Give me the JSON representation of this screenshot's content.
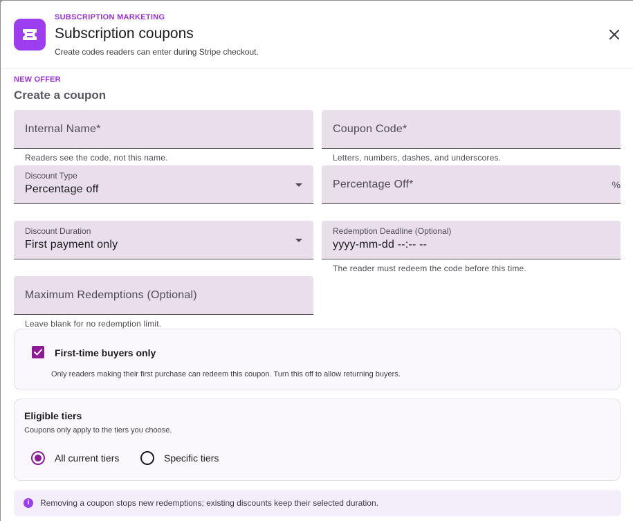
{
  "header": {
    "eyebrow": "SUBSCRIPTION MARKETING",
    "title": "Subscription coupons",
    "subtitle": "Create codes readers can enter during Stripe checkout.",
    "icon": "ticket-icon",
    "close_icon": "close-icon"
  },
  "section": {
    "eyebrow": "NEW OFFER",
    "title": "Create a coupon"
  },
  "fields": {
    "internal_name": {
      "placeholder": "Internal Name*",
      "help": "Readers see the code, not this name."
    },
    "coupon_code": {
      "placeholder": "Coupon Code*",
      "help": "Letters, numbers, dashes, and underscores."
    },
    "discount_type": {
      "label": "Discount Type",
      "value": "Percentage off"
    },
    "percentage_off": {
      "placeholder": "Percentage Off*",
      "suffix": "%"
    },
    "discount_duration": {
      "label": "Discount Duration",
      "value": "First payment only"
    },
    "redemption_deadline": {
      "label": "Redemption Deadline (Optional)",
      "value": "yyyy-mm-dd --:-- --",
      "help": "The reader must redeem the code before this time."
    },
    "max_redemptions": {
      "placeholder": "Maximum Redemptions (Optional)",
      "help": "Leave blank for no redemption limit."
    }
  },
  "first_time": {
    "label": "First-time buyers only",
    "checked": true,
    "description": "Only readers making their first purchase can redeem this coupon. Turn this off to allow returning buyers."
  },
  "tiers": {
    "title": "Eligible tiers",
    "description": "Coupons only apply to the tiers you choose.",
    "options": [
      {
        "label": "All current tiers",
        "selected": true
      },
      {
        "label": "Specific tiers",
        "selected": false
      }
    ]
  },
  "notice": {
    "icon": "info-icon",
    "text": "Removing a coupon stops new redemptions; existing discounts keep their selected duration."
  },
  "colors": {
    "accent": "#9c3ef0",
    "primary": "#8e1b97",
    "field_bg": "#e8dfea"
  }
}
